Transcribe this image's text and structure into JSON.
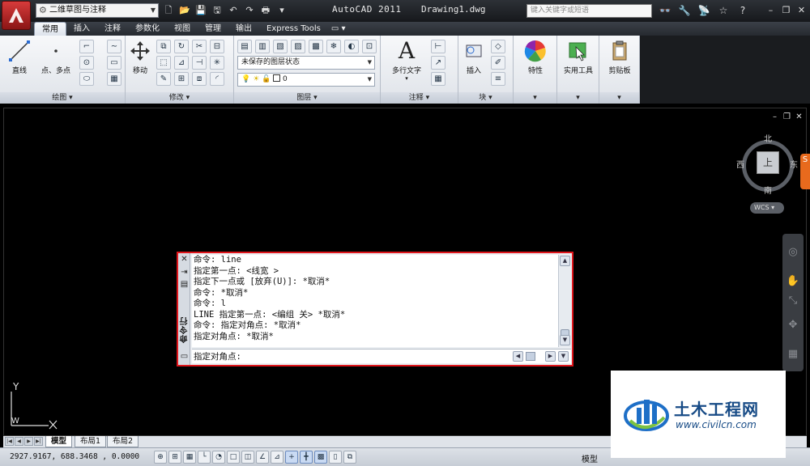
{
  "titlebar": {
    "workspace": "二维草图与注释",
    "app_title": "AutoCAD 2011",
    "file_name": "Drawing1.dwg",
    "search_placeholder": "键入关键字或短语"
  },
  "tabs": [
    {
      "label": "常用",
      "active": true
    },
    {
      "label": "插入"
    },
    {
      "label": "注释"
    },
    {
      "label": "参数化"
    },
    {
      "label": "视图"
    },
    {
      "label": "管理"
    },
    {
      "label": "输出"
    },
    {
      "label": "Express Tools"
    }
  ],
  "ribbon": {
    "draw": {
      "title": "绘图",
      "line": "直线",
      "point": "点、多点"
    },
    "modify": {
      "title": "修改",
      "move": "移动"
    },
    "layers": {
      "title": "图层",
      "layer_state": "未保存的图层状态",
      "current_layer": "0"
    },
    "annotation": {
      "title": "注释",
      "mtext": "多行文字"
    },
    "block": {
      "title": "块",
      "insert": "插入"
    },
    "properties": {
      "label": "特性"
    },
    "utilities": {
      "label": "实用工具"
    },
    "clipboard": {
      "label": "剪贴板"
    }
  },
  "viewcube": {
    "north": "北",
    "south": "南",
    "east": "东",
    "west": "西",
    "face": "上",
    "wcs": "WCS"
  },
  "ucs": {
    "y": "Y",
    "w": "W"
  },
  "command": {
    "vertical_title": "命令行",
    "history": [
      "命令: line",
      "指定第一点: <线宽 >",
      "指定下一点或 [放弃(U)]: *取消*",
      "命令: *取消*",
      "命令: l",
      "LINE 指定第一点: <编组 关> *取消*",
      "命令: 指定对角点: *取消*",
      "指定对角点: *取消*"
    ],
    "prompt": "指定对角点:"
  },
  "layouts": [
    {
      "label": "模型",
      "active": true
    },
    {
      "label": "布局1"
    },
    {
      "label": "布局2"
    }
  ],
  "statusbar": {
    "coords": "2927.9167, 688.3468 , 0.0000",
    "model": "模型"
  },
  "watermark": {
    "name": "土木工程网",
    "url": "www.civilcn.com"
  }
}
